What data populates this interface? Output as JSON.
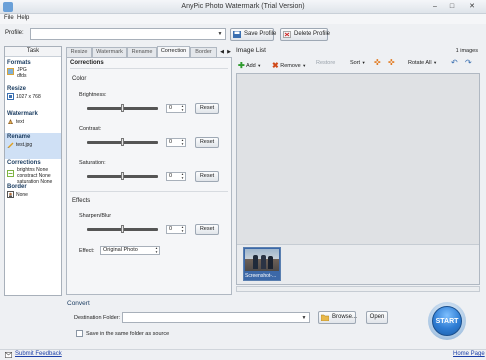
{
  "window": {
    "title": "AnyPic Photo Watermark (Trial Version)",
    "min": "–",
    "max": "□",
    "close": "✕"
  },
  "menu": {
    "file": "File",
    "help": "Help"
  },
  "profile": {
    "label": "Profile:",
    "value": "",
    "save": "Save Profile",
    "delete": "Delete Profile"
  },
  "task": {
    "header": "Task",
    "formats": {
      "title": "Formats",
      "line1": "JPG",
      "line2": "dfds"
    },
    "resize": {
      "title": "Resize",
      "value": "1027 x 768"
    },
    "watermark": {
      "title": "Watermark",
      "value": "text"
    },
    "rename": {
      "title": "Rename",
      "value": "test.jpg"
    },
    "corrections": {
      "title": "Corrections",
      "line1": "brightns None",
      "line2": "constract None",
      "line3": "saturation None"
    },
    "border": {
      "title": "Border",
      "value": "None"
    }
  },
  "tabs": [
    "Resize",
    "Watermark",
    "Rename",
    "Correction",
    "Border"
  ],
  "corrections": {
    "title": "Corrections",
    "color_group": "Color",
    "brightness": {
      "label": "Brightness:",
      "value": "0",
      "reset": "Reset"
    },
    "contrast": {
      "label": "Contrast:",
      "value": "0",
      "reset": "Reset"
    },
    "saturation": {
      "label": "Saturation:",
      "value": "0",
      "reset": "Reset"
    },
    "effects_group": "Effects",
    "sharpen": {
      "label": "Sharpen/Blur",
      "value": "0",
      "reset": "Reset"
    },
    "effect": {
      "label": "Effect:",
      "value": "Original Photo"
    }
  },
  "image_list": {
    "title": "Image List",
    "count": "1 images",
    "toolbar": {
      "add": "Add",
      "remove": "Remove",
      "restore": "Restore",
      "sort": "Sort",
      "rotate_all": "Rotate All"
    },
    "thumbnails": [
      {
        "label": "Screenshot-..."
      }
    ]
  },
  "convert": {
    "title": "Convert",
    "dest_label": "Destination Folder:",
    "dest_value": "",
    "browse": "Browse...",
    "open": "Open",
    "same_folder": "Save in the same folder as source",
    "start": "START"
  },
  "status": {
    "feedback": "Submit Feedback",
    "home": "Home Page"
  }
}
